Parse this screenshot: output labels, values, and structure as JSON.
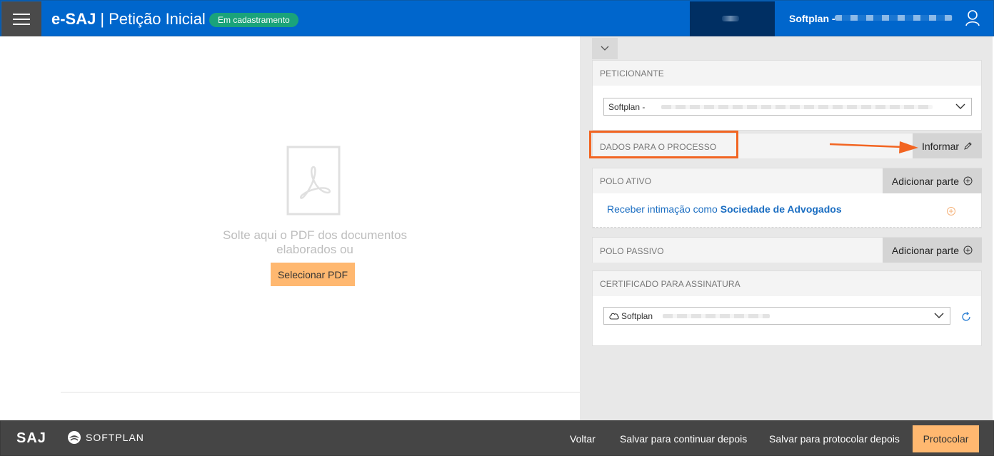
{
  "header": {
    "brand": "e-SAJ",
    "separator": "|",
    "title": "Petição Inicial",
    "status_badge": "Em cadastramento",
    "user_label": "Softplan -"
  },
  "drop_area": {
    "text": "Solte aqui o PDF dos documentos elaborados ou",
    "select_button": "Selecionar PDF"
  },
  "right_panel": {
    "peticionante": {
      "title": "PETICIONANTE",
      "selected_value": "Softplan -"
    },
    "dados_processo": {
      "title": "DADOS PARA O PROCESSO",
      "button": "Informar"
    },
    "polo_ativo": {
      "title": "POLO ATIVO",
      "button": "Adicionar parte",
      "link_prefix": "Receber intimação como",
      "link_bold": "Sociedade de Advogados"
    },
    "polo_passivo": {
      "title": "POLO PASSIVO",
      "button": "Adicionar parte"
    },
    "certificado": {
      "title": "CERTIFICADO PARA ASSINATURA",
      "selected_value": "Softplan"
    }
  },
  "footer": {
    "saj_logo": "SAJ",
    "softplan_logo": "SOFTPLAN",
    "voltar": "Voltar",
    "salvar_continuar": "Salvar para continuar depois",
    "salvar_protocolar": "Salvar para protocolar depois",
    "protocolar": "Protocolar"
  },
  "colors": {
    "header_blue": "#0066cc",
    "badge_green": "#1aa37a",
    "accent_orange": "#ffb870",
    "highlight_orange": "#f26522",
    "footer_gray": "#454545"
  },
  "icons": [
    "hamburger-menu-icon",
    "user-icon",
    "pdf-file-icon",
    "chevron-down-icon",
    "pencil-icon",
    "plus-circle-icon",
    "cloud-icon",
    "refresh-icon",
    "softplan-logo-icon"
  ]
}
